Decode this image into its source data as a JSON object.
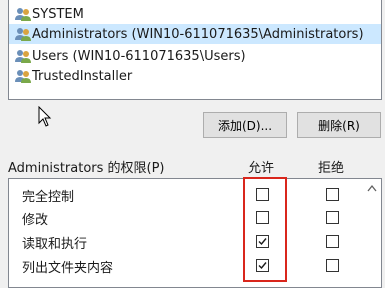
{
  "principals": [
    {
      "label": "SYSTEM",
      "selected": false,
      "icon": "group-icon"
    },
    {
      "label": "Administrators (WIN10-611071635\\Administrators)",
      "selected": true,
      "icon": "group-icon"
    },
    {
      "label": "Users (WIN10-611071635\\Users)",
      "selected": false,
      "icon": "group-icon"
    },
    {
      "label": "TrustedInstaller",
      "selected": false,
      "icon": "group-icon"
    }
  ],
  "buttons": {
    "add": "添加(D)...",
    "remove": "删除(R)"
  },
  "permissions": {
    "title": "Administrators 的权限(P)",
    "allow_header": "允许",
    "deny_header": "拒绝",
    "rows": [
      {
        "label": "完全控制",
        "allow": false,
        "deny": false
      },
      {
        "label": "修改",
        "allow": false,
        "deny": false
      },
      {
        "label": "读取和执行",
        "allow": true,
        "deny": false
      },
      {
        "label": "列出文件夹内容",
        "allow": true,
        "deny": false
      }
    ]
  },
  "colors": {
    "selection": "#cce8ff",
    "highlight_box": "#d9261c",
    "check": "#1a1a1a"
  }
}
